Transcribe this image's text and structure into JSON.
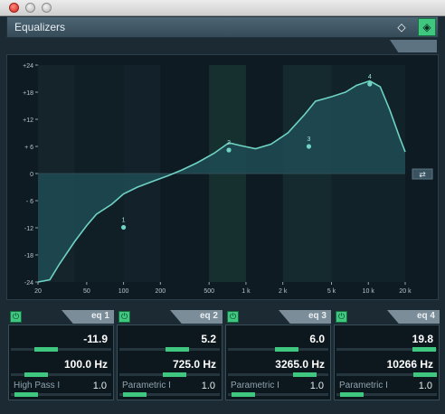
{
  "window": {
    "title": "Equalizers"
  },
  "colors": {
    "accent": "#3fc780",
    "curve": "#6fd4c4",
    "fill": "#1f4b53",
    "bg": "#0f1b22"
  },
  "graph": {
    "y_ticks": [
      "+24",
      "+18",
      "+12",
      "+ 6",
      "0",
      "- 6",
      "-12",
      "-18",
      "-24"
    ],
    "x_ticks": [
      "20",
      "50",
      "100",
      "200",
      "500",
      "1 k",
      "2 k",
      "5 k",
      "10 k",
      "20 k"
    ],
    "y_range": [
      -24,
      24
    ],
    "x_range_hz": [
      20,
      20000
    ],
    "node_labels": [
      "1",
      "2",
      "3",
      "4"
    ],
    "nodes": [
      {
        "freq": 100,
        "gain": -11.9
      },
      {
        "freq": 725,
        "gain": 5.2
      },
      {
        "freq": 3265,
        "gain": 6.0
      },
      {
        "freq": 10266,
        "gain": 19.8
      }
    ],
    "curve": [
      [
        20,
        -24
      ],
      [
        25,
        -23.5
      ],
      [
        30,
        -20
      ],
      [
        40,
        -15
      ],
      [
        50,
        -11.5
      ],
      [
        60,
        -9
      ],
      [
        80,
        -6.8
      ],
      [
        100,
        -4.5
      ],
      [
        130,
        -3
      ],
      [
        170,
        -1.8
      ],
      [
        230,
        -0.5
      ],
      [
        300,
        0.8
      ],
      [
        400,
        2.4
      ],
      [
        550,
        4.5
      ],
      [
        725,
        6.8
      ],
      [
        900,
        6.2
      ],
      [
        1200,
        5.5
      ],
      [
        1600,
        6.5
      ],
      [
        2200,
        9
      ],
      [
        3000,
        13
      ],
      [
        3700,
        16
      ],
      [
        5000,
        17
      ],
      [
        6500,
        18
      ],
      [
        8000,
        19.5
      ],
      [
        10266,
        20.5
      ],
      [
        12500,
        19.2
      ],
      [
        15000,
        14
      ],
      [
        18000,
        8
      ],
      [
        20000,
        4.8
      ]
    ]
  },
  "chart_data": {
    "type": "line",
    "title": "",
    "xlabel": "",
    "ylabel": "",
    "xscale": "log",
    "xlim": [
      20,
      20000
    ],
    "ylim": [
      -24,
      24
    ],
    "grid": false,
    "legend": "none"
  },
  "bands": [
    {
      "name": "eq 1",
      "power": "on",
      "gain": "-11.9",
      "freq": "100.0 Hz",
      "type": "High Pass I",
      "q": "1.0",
      "gain_pos": 0.35,
      "freq_pos": 0.25,
      "q_pos": 0.15
    },
    {
      "name": "eq 2",
      "power": "on",
      "gain": "5.2",
      "freq": "725.0 Hz",
      "type": "Parametric I",
      "q": "1.0",
      "gain_pos": 0.58,
      "freq_pos": 0.55,
      "q_pos": 0.15
    },
    {
      "name": "eq 3",
      "power": "on",
      "gain": "6.0",
      "freq": "3265.0 Hz",
      "type": "Parametric I",
      "q": "1.0",
      "gain_pos": 0.59,
      "freq_pos": 0.77,
      "q_pos": 0.15
    },
    {
      "name": "eq 4",
      "power": "on",
      "gain": "19.8",
      "freq": "10266 Hz",
      "type": "Parametric I",
      "q": "1.0",
      "gain_pos": 0.87,
      "freq_pos": 0.88,
      "q_pos": 0.15
    }
  ]
}
